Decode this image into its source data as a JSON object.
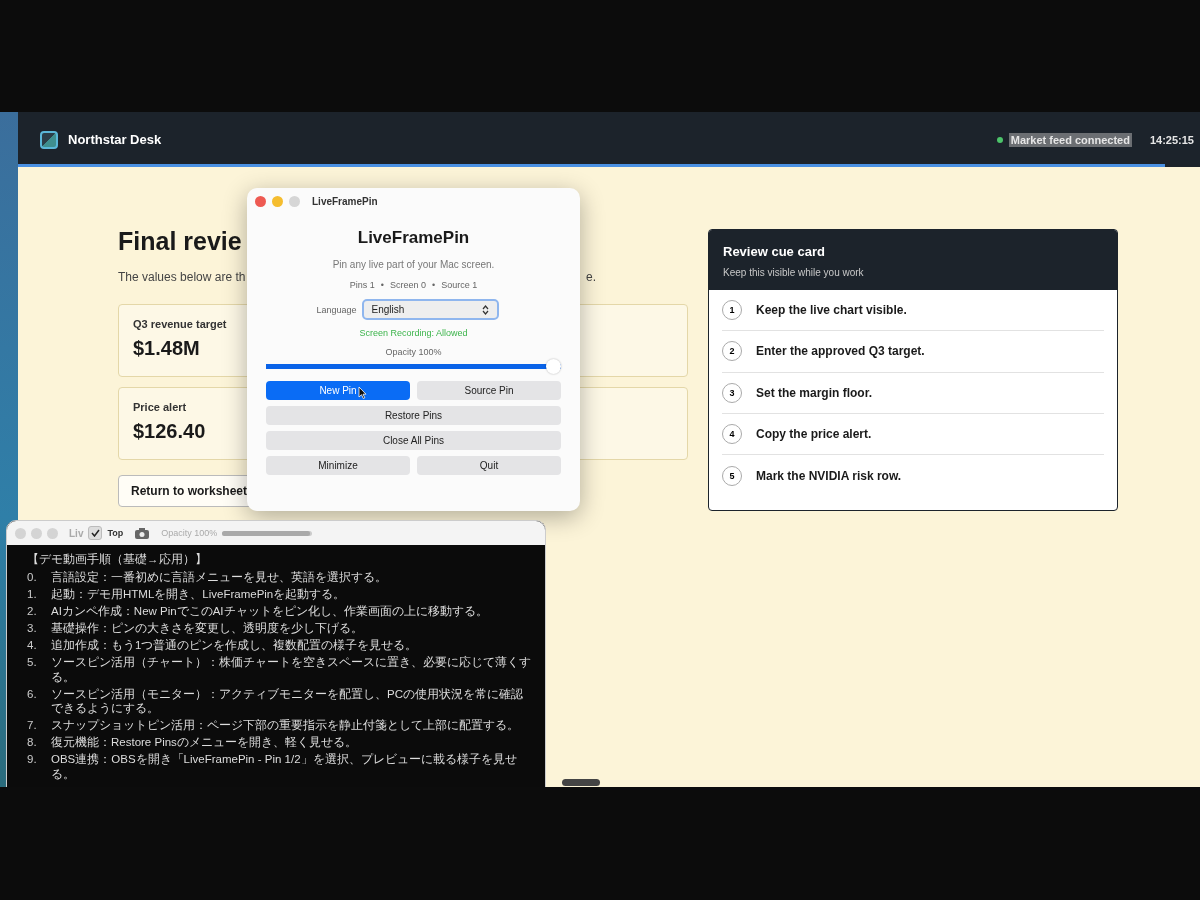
{
  "app": {
    "header": {
      "title": "Northstar Desk",
      "status": "Market feed connected",
      "time": "14:25:15",
      "progress": {
        "level": 0.97
      }
    },
    "page": {
      "title": "Final revie",
      "subtitle_start": "The values below are th",
      "subtitle_end": "e.",
      "metrics": [
        {
          "label": "Q3 revenue target",
          "value": "$1.48M"
        },
        {
          "label": "Price alert",
          "value": "$126.40"
        }
      ],
      "return_button": "Return to worksheet"
    },
    "cue_card": {
      "title": "Review cue card",
      "subtitle": "Keep this visible while you work",
      "steps": [
        {
          "number": "1",
          "text": "Keep the live chart visible."
        },
        {
          "number": "2",
          "text": "Enter the approved Q3 target."
        },
        {
          "number": "3",
          "text": "Set the margin floor."
        },
        {
          "number": "4",
          "text": "Copy the price alert."
        },
        {
          "number": "5",
          "text": "Mark the NVIDIA risk row."
        }
      ]
    }
  },
  "dialog": {
    "window_title": "LiveFramePin",
    "heading": "LiveFramePin",
    "tagline": "Pin any live part of your Mac screen.",
    "counts": [
      "Pins 1",
      "Screen 0",
      "Source 1"
    ],
    "separator": "•",
    "language_label": "Language",
    "language_value": "English",
    "permission": "Screen Recording: Allowed",
    "opacity_label": "Opacity 100%",
    "opacity": {
      "level": 1
    },
    "button_rows": [
      [
        {
          "label": "New Pin",
          "kind": "primary"
        },
        {
          "label": "Source Pin",
          "kind": "plain"
        }
      ],
      [
        {
          "label": "Restore Pins",
          "kind": "plain"
        }
      ],
      [
        {
          "label": "Close All Pins",
          "kind": "plain"
        }
      ],
      [
        {
          "label": "Minimize",
          "kind": "plain"
        },
        {
          "label": "Quit",
          "kind": "plain"
        }
      ]
    ]
  },
  "pin_window": {
    "title": "Liv",
    "top_checked": true,
    "top_label": "Top",
    "opacity_label": "Opacity 100%",
    "opacity": {
      "level": 0.97
    },
    "notes_title": "【デモ動画手順（基礎→応用）】",
    "steps": [
      {
        "number": "0.",
        "text": "言語設定：一番初めに言語メニューを見せ、英語を選択する。"
      },
      {
        "number": "1.",
        "text": "起動：デモ用HTMLを開き、LiveFramePinを起動する。"
      },
      {
        "number": "2.",
        "text": "AIカンペ作成：New PinでこのAIチャットをピン化し、作業画面の上に移動する。"
      },
      {
        "number": "3.",
        "text": "基礎操作：ピンの大きさを変更し、透明度を少し下げる。"
      },
      {
        "number": "4.",
        "text": "追加作成：もう1つ普通のピンを作成し、複数配置の様子を見せる。"
      },
      {
        "number": "5.",
        "text": "ソースピン活用（チャート）：株価チャートを空きスペースに置き、必要に応じて薄くする。"
      },
      {
        "number": "6.",
        "text": "ソースピン活用（モニター）：アクティブモニターを配置し、PCの使用状況を常に確認できるようにする。"
      },
      {
        "number": "7.",
        "text": "スナップショットピン活用：ページ下部の重要指示を静止付箋として上部に配置する。"
      },
      {
        "number": "8.",
        "text": "復元機能：Restore Pinsのメニューを開き、軽く見せる。"
      },
      {
        "number": "9.",
        "text": "OBS連携：OBSを開き「LiveFramePin - Pin 1/2」を選択、プレビューに載る様子を見せる。"
      }
    ]
  }
}
